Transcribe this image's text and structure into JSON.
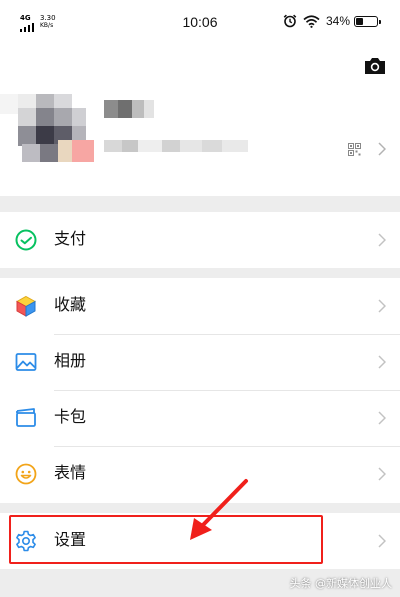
{
  "status_bar": {
    "network": "4G",
    "speed_value": "3.30",
    "speed_unit": "KB/s",
    "time": "10:06",
    "battery": "34%",
    "battery_level": 0.34,
    "icons": [
      "alarm-icon",
      "wifi-icon",
      "battery-icon"
    ]
  },
  "profile": {
    "icons": [
      "camera-icon",
      "qr-code-icon",
      "chevron-right-icon"
    ]
  },
  "menu": {
    "pay": {
      "label": "支付",
      "icon": "wechat-pay-icon",
      "color": "#07c160"
    },
    "favorites": {
      "label": "收藏",
      "icon": "favorites-cube-icon"
    },
    "album": {
      "label": "相册",
      "icon": "album-icon",
      "color": "#2c8ce8"
    },
    "cards": {
      "label": "卡包",
      "icon": "card-wallet-icon",
      "color": "#2c8ce8"
    },
    "stickers": {
      "label": "表情",
      "icon": "sticker-smiley-icon",
      "color": "#f2a419"
    },
    "settings": {
      "label": "设置",
      "icon": "gear-icon",
      "color": "#2c8ce8"
    }
  },
  "annotation": {
    "highlight_color": "#f0201b"
  },
  "watermark": "头条 @新媒体创业人"
}
